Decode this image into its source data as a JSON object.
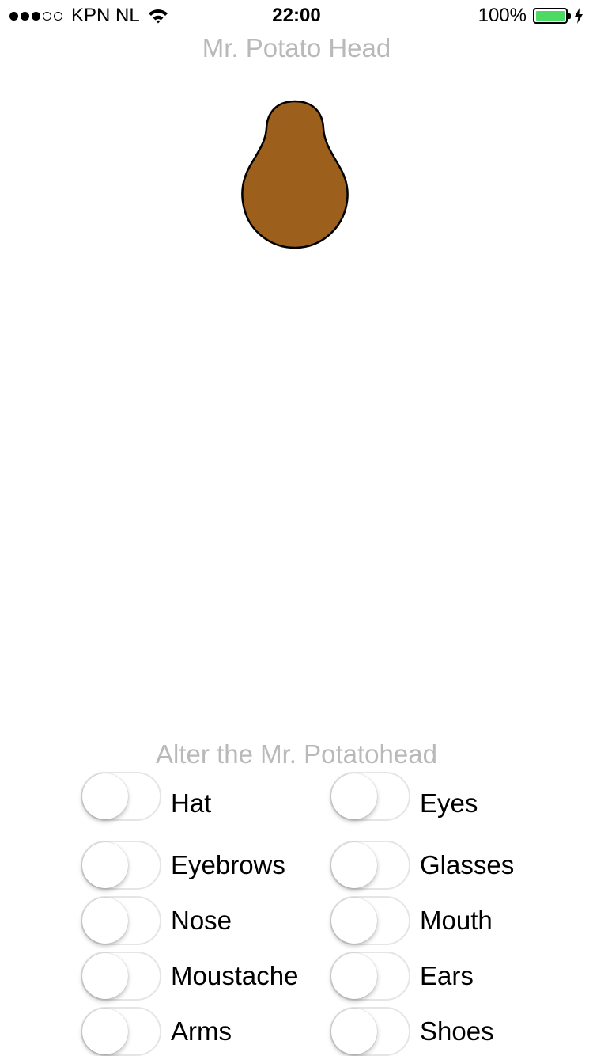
{
  "status_bar": {
    "carrier": "KPN NL",
    "time": "22:00",
    "battery_percent": "100%",
    "signal_bars_filled": 3,
    "signal_bars_total": 5,
    "battery_color": "#4cd964"
  },
  "title": "Mr. Potato Head",
  "potato_body": {
    "color": "#9c5f1c",
    "outline": "#000000"
  },
  "section_label": "Alter the Mr. Potatohead",
  "switch_colors": {
    "off_border": "#e5e5e5",
    "knob": "#ffffff"
  },
  "toggles": [
    {
      "label": "Hat",
      "on": false
    },
    {
      "label": "Eyes",
      "on": false
    },
    {
      "label": "Eyebrows",
      "on": false
    },
    {
      "label": "Glasses",
      "on": false
    },
    {
      "label": "Nose",
      "on": false
    },
    {
      "label": "Mouth",
      "on": false
    },
    {
      "label": "Moustache",
      "on": false
    },
    {
      "label": "Ears",
      "on": false
    },
    {
      "label": "Arms",
      "on": false
    },
    {
      "label": "Shoes",
      "on": false
    }
  ]
}
